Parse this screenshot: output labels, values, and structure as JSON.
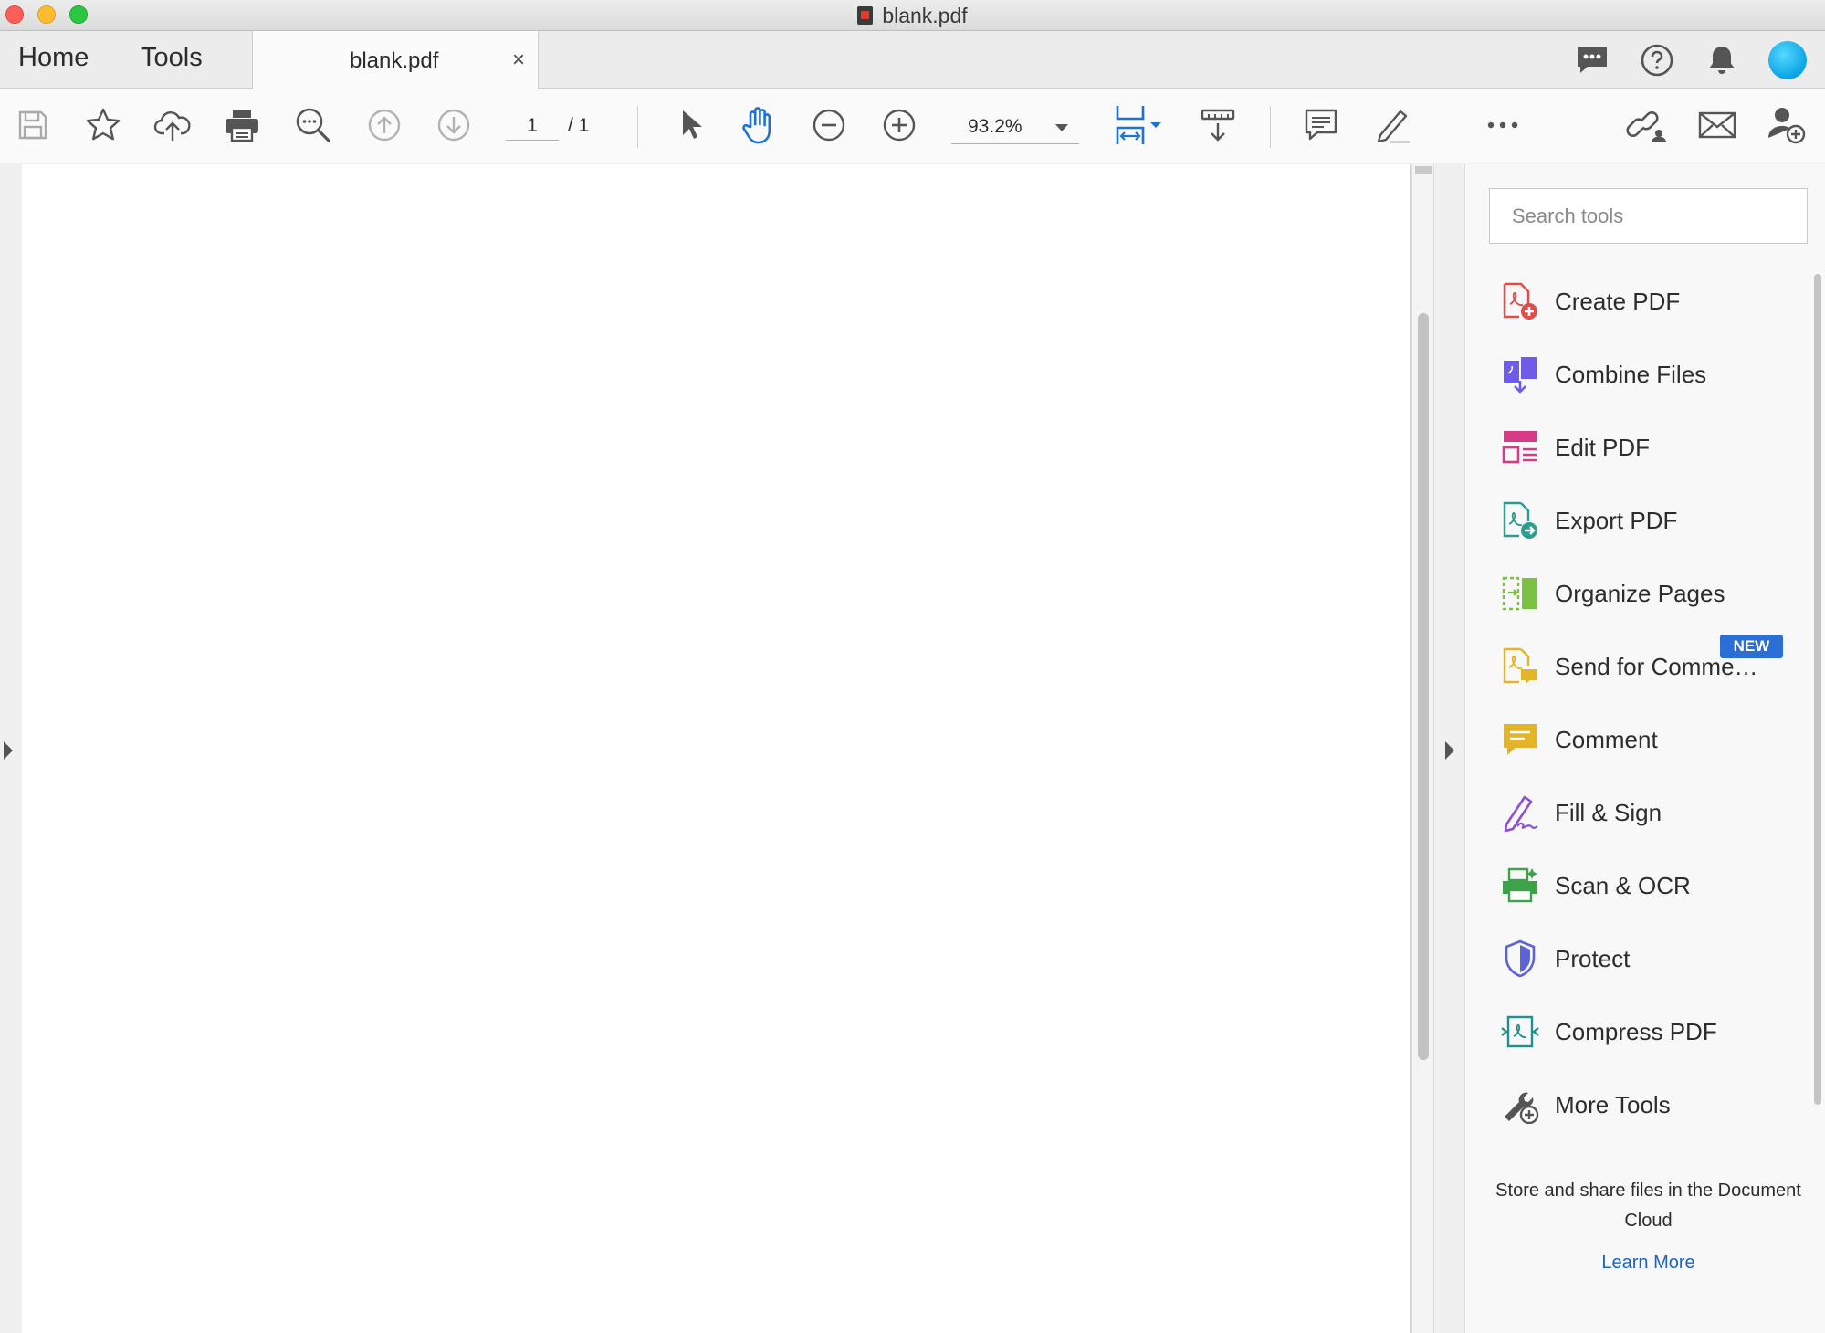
{
  "window": {
    "title": "blank.pdf"
  },
  "nav": {
    "home": "Home",
    "tools": "Tools",
    "doc_tab": "blank.pdf",
    "close_tab": "×"
  },
  "toolbar": {
    "page_current": "1",
    "page_total": "/ 1",
    "zoom": "93.2%",
    "accent_color": "#1e73d2"
  },
  "tools_pane": {
    "search_placeholder": "Search tools",
    "items": [
      {
        "label": "Create PDF",
        "icon": "create-pdf-icon",
        "color": "#e34b4b"
      },
      {
        "label": "Combine Files",
        "icon": "combine-files-icon",
        "color": "#6c5ce7"
      },
      {
        "label": "Edit PDF",
        "icon": "edit-pdf-icon",
        "color": "#d63c86"
      },
      {
        "label": "Export PDF",
        "icon": "export-pdf-icon",
        "color": "#2a9d8f"
      },
      {
        "label": "Organize Pages",
        "icon": "organize-pages-icon",
        "color": "#7cc242"
      },
      {
        "label": "Send for Comme…",
        "icon": "send-for-comment-icon",
        "color": "#e3b52b",
        "badge": "NEW"
      },
      {
        "label": "Comment",
        "icon": "comment-icon",
        "color": "#e3b52b"
      },
      {
        "label": "Fill & Sign",
        "icon": "fill-sign-icon",
        "color": "#8a4fd6"
      },
      {
        "label": "Scan & OCR",
        "icon": "scan-ocr-icon",
        "color": "#3ea24a"
      },
      {
        "label": "Protect",
        "icon": "protect-icon",
        "color": "#5b63d6"
      },
      {
        "label": "Compress PDF",
        "icon": "compress-pdf-icon",
        "color": "#1f8f8f"
      },
      {
        "label": "More Tools",
        "icon": "more-tools-icon",
        "color": "#555555"
      }
    ],
    "cloud_text": "Store and share files in the Document Cloud",
    "learn_more": "Learn More"
  }
}
